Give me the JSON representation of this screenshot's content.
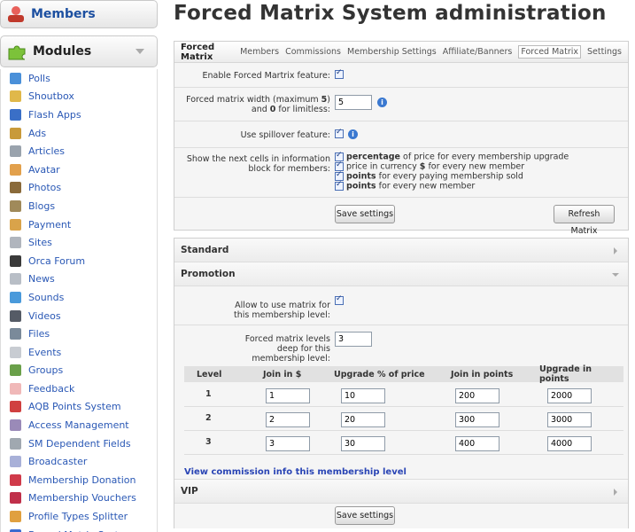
{
  "sidebar": {
    "members_label": "Members",
    "modules_label": "Modules",
    "items": [
      {
        "label": "Polls",
        "color": "#4a90d9"
      },
      {
        "label": "Shoutbox",
        "color": "#e0b84a"
      },
      {
        "label": "Flash Apps",
        "color": "#3a6fc7"
      },
      {
        "label": "Ads",
        "color": "#c89a3a"
      },
      {
        "label": "Articles",
        "color": "#9aa3ad"
      },
      {
        "label": "Avatar",
        "color": "#e2a04c"
      },
      {
        "label": "Photos",
        "color": "#8a6a3a"
      },
      {
        "label": "Blogs",
        "color": "#a08a5a"
      },
      {
        "label": "Payment",
        "color": "#d9a34a"
      },
      {
        "label": "Sites",
        "color": "#b0b5bd"
      },
      {
        "label": "Orca Forum",
        "color": "#3a3a3a"
      },
      {
        "label": "News",
        "color": "#b8bec6"
      },
      {
        "label": "Sounds",
        "color": "#4a9adb"
      },
      {
        "label": "Videos",
        "color": "#555b66"
      },
      {
        "label": "Files",
        "color": "#7a8a9a"
      },
      {
        "label": "Events",
        "color": "#c8ccd2"
      },
      {
        "label": "Groups",
        "color": "#6aa04a"
      },
      {
        "label": "Feedback",
        "color": "#f0b8b8"
      },
      {
        "label": "AQB Points System",
        "color": "#d04040"
      },
      {
        "label": "Access Management",
        "color": "#9a8ab8"
      },
      {
        "label": "SM Dependent Fields",
        "color": "#a0a8b0"
      },
      {
        "label": "Broadcaster",
        "color": "#a8b0d8"
      },
      {
        "label": "Membership Donation",
        "color": "#d03a4a"
      },
      {
        "label": "Membership Vouchers",
        "color": "#c0304a"
      },
      {
        "label": "Profile Types Splitter",
        "color": "#e0a040"
      },
      {
        "label": "Forced Matrix System",
        "color": "#3a6ad0"
      }
    ]
  },
  "page_title": "Forced Matrix System administration",
  "settings_panel": {
    "caption": "Forced Matrix",
    "tabs": [
      "Members",
      "Commissions",
      "Membership Settings",
      "Affiliate/Banners",
      "Forced Matrix",
      "Settings"
    ],
    "active_tab": "Forced Matrix",
    "enable_label": "Enable Forced Martrix feature:",
    "width_label_1": "Forced matrix width (maximum ",
    "width_label_max": "5",
    "width_label_2": ")",
    "width_label_3": "and ",
    "width_label_zero": "0",
    "width_label_4": " for limitless:",
    "width_value": "5",
    "spillover_label": "Use spillover feature:",
    "show_label_1": "Show the next cells in information",
    "show_label_2": "block for members:",
    "options": [
      {
        "bold": "percentage",
        "rest": " of price for every membership upgrade"
      },
      {
        "bold": "",
        "rest": "price in currency ",
        "bold2": "$",
        "rest2": " for every new member"
      },
      {
        "bold": "points",
        "rest": " for every paying membership sold"
      },
      {
        "bold": "points",
        "rest": " for every new member"
      }
    ],
    "save_label": "Save settings",
    "refresh_label": "Refresh Matrix"
  },
  "levels_panel": {
    "standard_label": "Standard",
    "promotion_label": "Promotion",
    "allow_label_1": "Allow to use matrix for",
    "allow_label_2": "this membership level:",
    "deep_label_1": "Forced matrix levels",
    "deep_label_2": "deep for this",
    "deep_label_3": "membership level:",
    "deep_value": "3",
    "columns": [
      "Level",
      "Join in $",
      "Upgrade % of price",
      "Join in points",
      "Upgrade in points"
    ],
    "rows": [
      {
        "level": "1",
        "join": "1",
        "upgrade_pct": "10",
        "join_points": "200",
        "upgrade_points": "2000"
      },
      {
        "level": "2",
        "join": "2",
        "upgrade_pct": "20",
        "join_points": "300",
        "upgrade_points": "3000"
      },
      {
        "level": "3",
        "join": "3",
        "upgrade_pct": "30",
        "join_points": "400",
        "upgrade_points": "4000"
      }
    ],
    "view_link": "View commission info this membership level",
    "vip_label": "VIP",
    "save_label": "Save settings"
  }
}
